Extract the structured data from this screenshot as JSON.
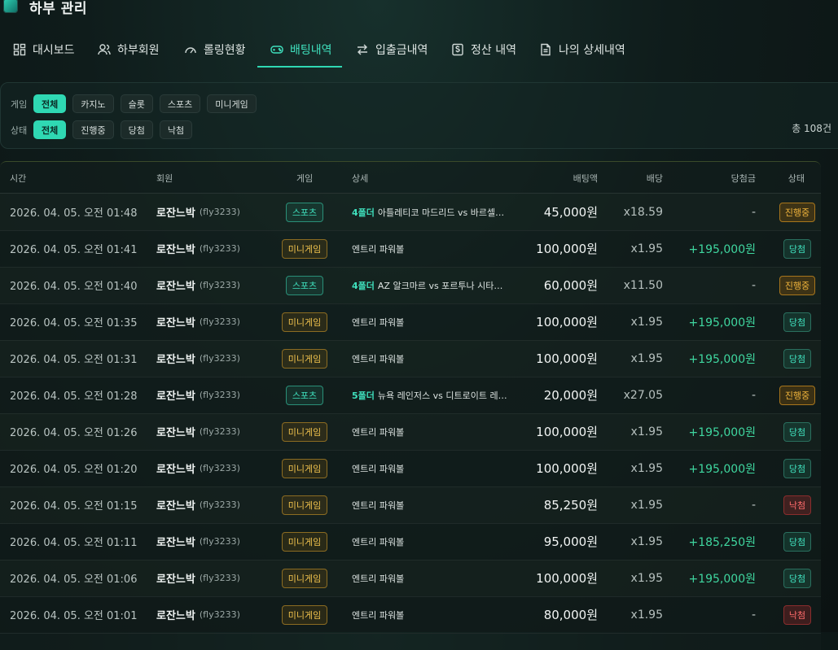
{
  "header": {
    "title": "하부 관리"
  },
  "tabs": [
    {
      "label": "대시보드",
      "icon": "dashboard-icon"
    },
    {
      "label": "하부회원",
      "icon": "users-icon"
    },
    {
      "label": "롤링현황",
      "icon": "gauge-icon"
    },
    {
      "label": "배팅내역",
      "icon": "gamepad-icon",
      "active": true
    },
    {
      "label": "입출금내역",
      "icon": "transfer-icon"
    },
    {
      "label": "정산 내역",
      "icon": "dollar-icon"
    },
    {
      "label": "나의 상세내역",
      "icon": "document-icon"
    }
  ],
  "filters": {
    "game_label": "게임",
    "game_options": [
      "전체",
      "카지노",
      "슬롯",
      "스포츠",
      "미니게임"
    ],
    "game_selected": "전체",
    "status_label": "상태",
    "status_options": [
      "전체",
      "진행중",
      "당첨",
      "낙첨"
    ],
    "status_selected": "전체",
    "total": "총 108건"
  },
  "table": {
    "headers": [
      "시간",
      "회원",
      "게임",
      "상세",
      "배팅액",
      "배당",
      "당첨금",
      "상태"
    ],
    "rows": [
      {
        "time": "2026. 04. 05. 오전 01:48",
        "member": "로잔느박",
        "uid": "(fly3233)",
        "game": "스포츠",
        "game_type": "sports",
        "fold": "4폴더",
        "detail": "아틀레티코 마드리드 vs 바르셀…",
        "amount": "45,000원",
        "odds": "x18.59",
        "win": "-",
        "status": "진행중",
        "status_type": "progress"
      },
      {
        "time": "2026. 04. 05. 오전 01:41",
        "member": "로잔느박",
        "uid": "(fly3233)",
        "game": "미니게임",
        "game_type": "mini",
        "fold": "",
        "detail": "엔트리 파워볼",
        "amount": "100,000원",
        "odds": "x1.95",
        "win": "+195,000원",
        "status": "당첨",
        "status_type": "win"
      },
      {
        "time": "2026. 04. 05. 오전 01:40",
        "member": "로잔느박",
        "uid": "(fly3233)",
        "game": "스포츠",
        "game_type": "sports",
        "fold": "4폴더",
        "detail": "AZ 알크마르 vs 포르투나 시타…",
        "amount": "60,000원",
        "odds": "x11.50",
        "win": "-",
        "status": "진행중",
        "status_type": "progress"
      },
      {
        "time": "2026. 04. 05. 오전 01:35",
        "member": "로잔느박",
        "uid": "(fly3233)",
        "game": "미니게임",
        "game_type": "mini",
        "fold": "",
        "detail": "엔트리 파워볼",
        "amount": "100,000원",
        "odds": "x1.95",
        "win": "+195,000원",
        "status": "당첨",
        "status_type": "win"
      },
      {
        "time": "2026. 04. 05. 오전 01:31",
        "member": "로잔느박",
        "uid": "(fly3233)",
        "game": "미니게임",
        "game_type": "mini",
        "fold": "",
        "detail": "엔트리 파워볼",
        "amount": "100,000원",
        "odds": "x1.95",
        "win": "+195,000원",
        "status": "당첨",
        "status_type": "win"
      },
      {
        "time": "2026. 04. 05. 오전 01:28",
        "member": "로잔느박",
        "uid": "(fly3233)",
        "game": "스포츠",
        "game_type": "sports",
        "fold": "5폴더",
        "detail": "뉴욕 레인저스 vs 디트로이트 레…",
        "amount": "20,000원",
        "odds": "x27.05",
        "win": "-",
        "status": "진행중",
        "status_type": "progress"
      },
      {
        "time": "2026. 04. 05. 오전 01:26",
        "member": "로잔느박",
        "uid": "(fly3233)",
        "game": "미니게임",
        "game_type": "mini",
        "fold": "",
        "detail": "엔트리 파워볼",
        "amount": "100,000원",
        "odds": "x1.95",
        "win": "+195,000원",
        "status": "당첨",
        "status_type": "win"
      },
      {
        "time": "2026. 04. 05. 오전 01:20",
        "member": "로잔느박",
        "uid": "(fly3233)",
        "game": "미니게임",
        "game_type": "mini",
        "fold": "",
        "detail": "엔트리 파워볼",
        "amount": "100,000원",
        "odds": "x1.95",
        "win": "+195,000원",
        "status": "당첨",
        "status_type": "win"
      },
      {
        "time": "2026. 04. 05. 오전 01:15",
        "member": "로잔느박",
        "uid": "(fly3233)",
        "game": "미니게임",
        "game_type": "mini",
        "fold": "",
        "detail": "엔트리 파워볼",
        "amount": "85,250원",
        "odds": "x1.95",
        "win": "-",
        "status": "낙첨",
        "status_type": "lose"
      },
      {
        "time": "2026. 04. 05. 오전 01:11",
        "member": "로잔느박",
        "uid": "(fly3233)",
        "game": "미니게임",
        "game_type": "mini",
        "fold": "",
        "detail": "엔트리 파워볼",
        "amount": "95,000원",
        "odds": "x1.95",
        "win": "+185,250원",
        "status": "당첨",
        "status_type": "win"
      },
      {
        "time": "2026. 04. 05. 오전 01:06",
        "member": "로잔느박",
        "uid": "(fly3233)",
        "game": "미니게임",
        "game_type": "mini",
        "fold": "",
        "detail": "엔트리 파워볼",
        "amount": "100,000원",
        "odds": "x1.95",
        "win": "+195,000원",
        "status": "당첨",
        "status_type": "win"
      },
      {
        "time": "2026. 04. 05. 오전 01:01",
        "member": "로잔느박",
        "uid": "(fly3233)",
        "game": "미니게임",
        "game_type": "mini",
        "fold": "",
        "detail": "엔트리 파워볼",
        "amount": "80,000원",
        "odds": "x1.95",
        "win": "-",
        "status": "낙첨",
        "status_type": "lose"
      }
    ]
  },
  "colors": {
    "accent": "#2fd8b3",
    "progress": "#f0b43c",
    "win": "#3fd69f",
    "lose": "#ff6b6b"
  }
}
